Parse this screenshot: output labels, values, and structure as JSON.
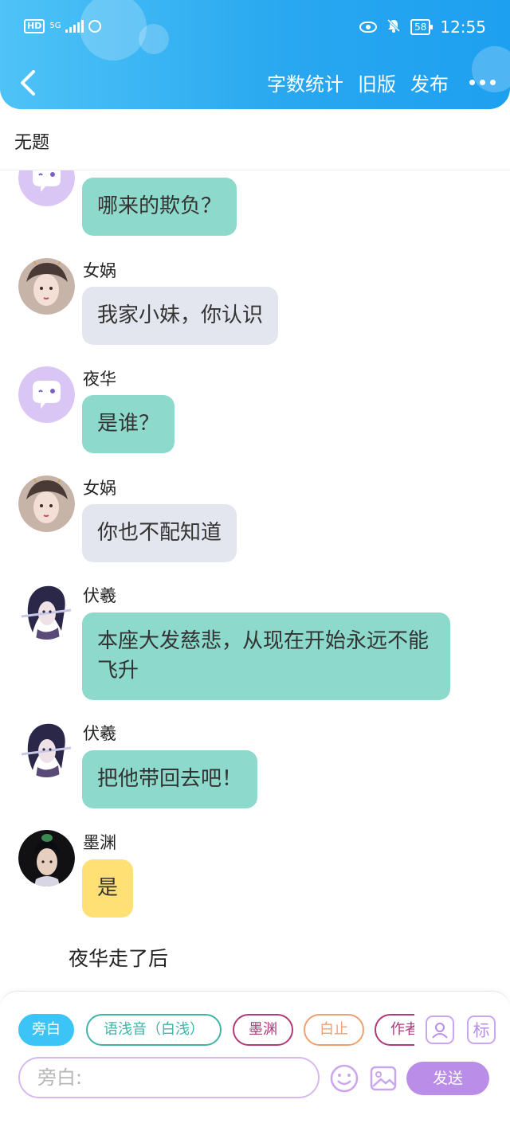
{
  "status_bar": {
    "hd": "HD",
    "network": "5G",
    "battery": "58",
    "time": "12:55",
    "icons": [
      "hd-icon",
      "signal-icon",
      "wifi-icon",
      "eye-icon",
      "bell-off-icon",
      "battery-icon"
    ]
  },
  "header": {
    "back_icon": "chevron-left-icon",
    "actions": {
      "word_count": "字数统计",
      "old_version": "旧版",
      "publish": "发布"
    },
    "more_icon": "more-dots-icon",
    "background": "#29a8f0"
  },
  "document": {
    "title": "无题"
  },
  "messages": [
    {
      "speaker": "",
      "text": "哪来的欺负？",
      "bubble": "green",
      "avatar": "ghost-avatar"
    },
    {
      "speaker": "女娲",
      "text": "我家小妹，你认识",
      "bubble": "gray",
      "avatar": "nuwa-avatar"
    },
    {
      "speaker": "夜华",
      "text": "是谁？",
      "bubble": "green",
      "avatar": "ghost-avatar"
    },
    {
      "speaker": "女娲",
      "text": "你也不配知道",
      "bubble": "gray",
      "avatar": "nuwa-avatar"
    },
    {
      "speaker": "伏羲",
      "text": "本座大发慈悲，从现在开始永远不能飞升",
      "bubble": "green",
      "avatar": "fuxi-avatar"
    },
    {
      "speaker": "伏羲",
      "text": "把他带回去吧！",
      "bubble": "green",
      "avatar": "fuxi-avatar"
    },
    {
      "speaker": "墨渊",
      "text": "是",
      "bubble": "yellow",
      "avatar": "moyuan-avatar"
    }
  ],
  "narration": "夜华走了后",
  "composer": {
    "chips": [
      {
        "label": "旁白",
        "active": true
      },
      {
        "label": "语浅音（白浅）",
        "active": false,
        "color": "#3fb5a8"
      },
      {
        "label": "墨渊",
        "active": false,
        "color": "#b03a7a"
      },
      {
        "label": "白止",
        "active": false,
        "color": "#f0a070"
      },
      {
        "label": "作者",
        "active": false,
        "color": "#b03a7a"
      }
    ],
    "role_icon": "person-card-icon",
    "mark_label": "标",
    "input_placeholder": "旁白:",
    "input_value": "",
    "emoji_icon": "smiley-icon",
    "image_icon": "image-icon",
    "send_label": "发送",
    "colors": {
      "bubble_green": "#8dd9cc",
      "bubble_gray": "#e3e6ee",
      "bubble_yellow": "#fee074",
      "accent_purple": "#b98de8"
    }
  }
}
